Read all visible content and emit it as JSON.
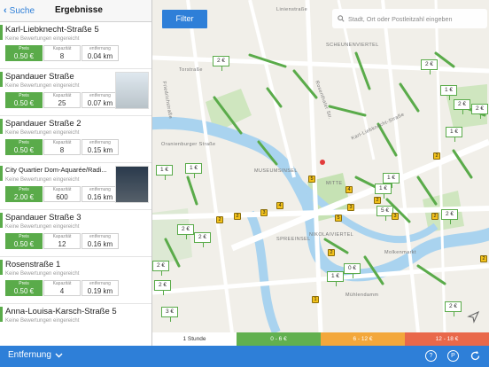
{
  "nav": {
    "back_label": "Suche",
    "title": "Ergebnisse"
  },
  "results": [
    {
      "name": "Karl-Liebknecht-Straße 5",
      "review": "Keine Bewertungen eingereicht",
      "price_label": "Preis",
      "price": "0.50 €",
      "capacity_label": "Kapazität",
      "capacity": "8",
      "distance_label": "entfernung",
      "distance": "0.04 km",
      "thumb": false
    },
    {
      "name": "Spandauer Straße",
      "review": "Keine Bewertungen eingereicht",
      "price_label": "Preis",
      "price": "0.50 €",
      "capacity_label": "Kapazität",
      "capacity": "25",
      "distance_label": "entfernung",
      "distance": "0.07 km",
      "thumb": true
    },
    {
      "name": "Spandauer Straße 2",
      "review": "Keine Bewertungen eingereicht",
      "price_label": "Preis",
      "price": "0.50 €",
      "capacity_label": "Kapazität",
      "capacity": "8",
      "distance_label": "entfernung",
      "distance": "0.15 km",
      "thumb": false
    },
    {
      "name": "City Quartier Dom-Aquarée/Radi...",
      "review": "Keine Bewertungen eingereicht",
      "price_label": "Preis",
      "price": "2.00 €",
      "capacity_label": "Kapazität",
      "capacity": "600",
      "distance_label": "entfernung",
      "distance": "0.16 km",
      "thumb": true
    },
    {
      "name": "Spandauer Straße 3",
      "review": "Keine Bewertungen eingereicht",
      "price_label": "Preis",
      "price": "0.50 €",
      "capacity_label": "Kapazität",
      "capacity": "12",
      "distance_label": "entfernung",
      "distance": "0.16 km",
      "thumb": false
    },
    {
      "name": "Rosenstraße 1",
      "review": "Keine Bewertungen eingereicht",
      "price_label": "Preis",
      "price": "0.50 €",
      "capacity_label": "Kapazität",
      "capacity": "4",
      "distance_label": "entfernung",
      "distance": "0.19 km",
      "thumb": false
    },
    {
      "name": "Anna-Louisa-Karsch-Straße 5",
      "review": "Keine Bewertungen eingereicht",
      "price_label": "",
      "price": "",
      "capacity_label": "",
      "capacity": "",
      "distance_label": "",
      "distance": "",
      "thumb": false
    }
  ],
  "map": {
    "filter_label": "Filter",
    "search_placeholder": "Stadt, Ort oder Postleitzahl eingeben",
    "labels": [
      "SCHEUNENVIERTEL",
      "MUSEUMSINSEL",
      "MITTE",
      "SPREEINSEL",
      "NIKOLAIVIERTEL",
      "Molkenmarkt",
      "Linienstraße",
      "Torstraße",
      "Karl-Liebknecht-Straße",
      "Rosenthaler Str.",
      "Oranienburger Straße",
      "Friedrichstraße",
      "Mühlendamm"
    ],
    "pins": [
      "2 €",
      "2 €",
      "1 €",
      "2 €",
      "1 €",
      "2 €",
      "1 €",
      "1 €",
      "1 €",
      "1 €",
      "5 €",
      "2 €",
      "2 €",
      "2 €",
      "0 €",
      "1 €",
      "2 €",
      "2 €",
      "3 €",
      "2 €"
    ],
    "badges": [
      "2",
      "5",
      "3",
      "4",
      "2",
      "2",
      "3",
      "5",
      "2",
      "2",
      "1",
      "2",
      "4",
      "3",
      "2"
    ]
  },
  "legend": [
    "1 Stunde",
    "0 - 6 €",
    "6 - 12 €",
    "12 - 18 €"
  ],
  "bottom": {
    "sort_label": "Entfernung",
    "help_icon": "?",
    "parking_icon": "P"
  },
  "colors": {
    "accent": "#2e7fd8",
    "green": "#5aab4a",
    "orange": "#f3a73b",
    "red": "#e9684a"
  }
}
